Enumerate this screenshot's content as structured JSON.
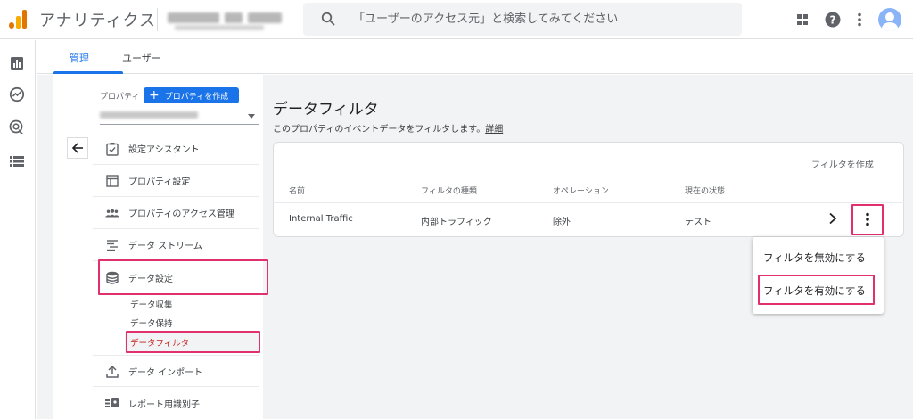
{
  "app": {
    "title": "アナリティクス"
  },
  "search": {
    "placeholder": "「ユーザーのアクセス元」と検索してみてください"
  },
  "tabs": [
    {
      "label": "管理",
      "active": true
    },
    {
      "label": "ユーザー",
      "active": false
    }
  ],
  "property": {
    "label": "プロパティ",
    "create_button": "プロパティを作成"
  },
  "nav": {
    "items": [
      {
        "label": "設定アシスタント"
      },
      {
        "label": "プロパティ設定"
      },
      {
        "label": "プロパティのアクセス管理"
      },
      {
        "label": "データ ストリーム"
      },
      {
        "label": "データ設定"
      },
      {
        "label": "データ インポート"
      },
      {
        "label": "レポート用識別子"
      }
    ],
    "sub_items": [
      {
        "label": "データ収集"
      },
      {
        "label": "データ保持"
      },
      {
        "label": "データフィルタ"
      }
    ]
  },
  "main": {
    "title": "データフィルタ",
    "description": "このプロパティのイベントデータをフィルタします。",
    "learn_more": "詳細",
    "create_filter": "フィルタを作成",
    "table": {
      "headers": [
        "名前",
        "フィルタの種類",
        "オペレーション",
        "現在の状態"
      ],
      "rows": [
        [
          "Internal Traffic",
          "内部トラフィック",
          "除外",
          "テスト"
        ]
      ]
    }
  },
  "menu": {
    "items": [
      {
        "label": "フィルタを無効にする"
      },
      {
        "label": "フィルタを有効にする"
      }
    ]
  },
  "colors": {
    "accent": "#1a73e8",
    "highlight": "#e0306d",
    "active_sub": "#c5221f"
  }
}
